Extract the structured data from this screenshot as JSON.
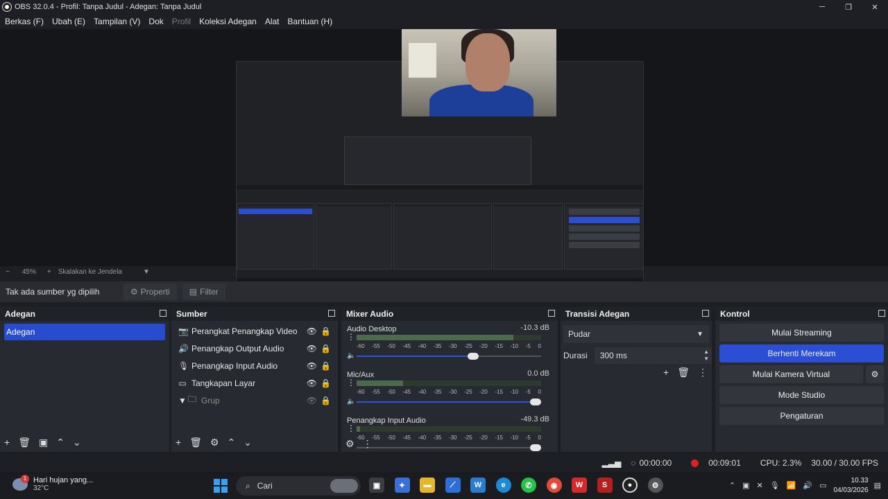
{
  "window": {
    "title": "OBS 32.0.4 - Profil: Tanpa Judul - Adegan: Tanpa Judul",
    "minimize": "─",
    "maximize": "❐",
    "close": "✕"
  },
  "menu": [
    {
      "label": "Berkas (F)",
      "disabled": false
    },
    {
      "label": "Ubah (E)",
      "disabled": false
    },
    {
      "label": "Tampilan (V)",
      "disabled": false
    },
    {
      "label": "Dok",
      "disabled": false
    },
    {
      "label": "Profil",
      "disabled": true
    },
    {
      "label": "Koleksi Adegan",
      "disabled": false
    },
    {
      "label": "Alat",
      "disabled": false
    },
    {
      "label": "Bantuan (H)",
      "disabled": false
    }
  ],
  "zoom": {
    "minus": "−",
    "value": "45%",
    "plus": "+",
    "mode": "Skalakan ke Jendela"
  },
  "context": {
    "no_source": "Tak ada sumber yg dipilih",
    "properties": "Properti",
    "filters": "Filter"
  },
  "scenes": {
    "title": "Adegan",
    "items": [
      "Adegan"
    ]
  },
  "sources": {
    "title": "Sumber",
    "items": [
      {
        "label": "Perangkat Penangkap Video",
        "icon": "camera-icon"
      },
      {
        "label": "Penangkap Output Audio",
        "icon": "speaker-icon"
      },
      {
        "label": "Penangkap Input Audio",
        "icon": "microphone-icon"
      },
      {
        "label": "Tangkapan Layar",
        "icon": "monitor-icon"
      },
      {
        "label": "Grup",
        "icon": "folder-icon"
      }
    ]
  },
  "mixer": {
    "title": "Mixer Audio",
    "channels": [
      {
        "name": "Audio Desktop",
        "db": "-10.3 dB",
        "level": 0.85,
        "volume": 0.66,
        "muted": true
      },
      {
        "name": "Mic/Aux",
        "db": "0.0 dB",
        "level": 0.25,
        "volume": 1.0,
        "muted": true
      },
      {
        "name": "Penangkap Input Audio",
        "db": "-49.3 dB",
        "level": 0.02,
        "volume": 1.0,
        "muted": false
      }
    ],
    "scale": [
      "-60",
      "-55",
      "-50",
      "-45",
      "-40",
      "-35",
      "-30",
      "-25",
      "-20",
      "-15",
      "-10",
      "-5",
      "0"
    ]
  },
  "transitions": {
    "title": "Transisi Adegan",
    "selected": "Pudar",
    "duration_label": "Durasi",
    "duration_value": "300 ms"
  },
  "controls": {
    "title": "Kontrol",
    "start_streaming": "Mulai Streaming",
    "stop_recording": "Berhenti Merekam",
    "virtual_camera": "Mulai Kamera Virtual",
    "studio_mode": "Mode Studio",
    "settings": "Pengaturan"
  },
  "status": {
    "stream_time": "00:00:00",
    "rec_time": "00:09:01",
    "cpu": "CPU: 2.3%",
    "fps": "30.00 / 30.00 FPS"
  },
  "taskbar": {
    "weather_text": "Hari hujan yang...",
    "weather_temp": "32°C",
    "weather_badge": "1",
    "search": "Cari",
    "time": "10.33",
    "date": "04/03/2026"
  }
}
